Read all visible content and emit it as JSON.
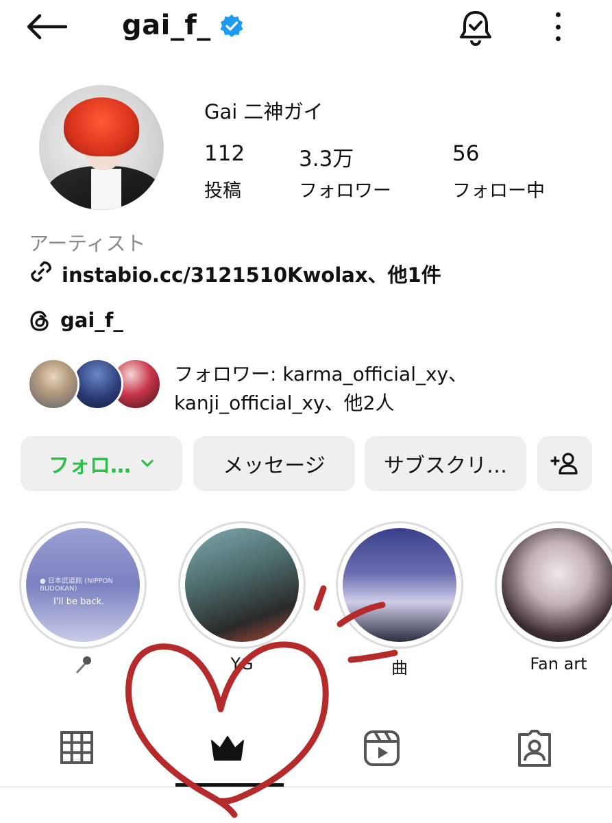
{
  "header": {
    "username": "gai_f_"
  },
  "profile": {
    "display_name": "Gai 二神ガイ",
    "stats": [
      {
        "value": "112",
        "label": "投稿"
      },
      {
        "value": "3.3万",
        "label": "フォロワー"
      },
      {
        "value": "56",
        "label": "フォロー中"
      }
    ],
    "category": "アーティスト",
    "link": "instabio.cc/3121510Kwolax、他1件",
    "threads_handle": "gai_f_",
    "followed_by_line1": "フォロワー: karma_official_xy、",
    "followed_by_line2": "kanji_official_xy、他2人"
  },
  "actions": {
    "follow_label": "フォロ…",
    "message_label": "メッセージ",
    "subscribe_label": "サブスクリ…"
  },
  "highlights": [
    {
      "label": "",
      "icon": "microphone-icon",
      "thumb_text_small": "● 日本武道館 (NIPPON BUDOKAN)",
      "thumb_text_big": "I'll be back."
    },
    {
      "label": "YG"
    },
    {
      "label": "曲"
    },
    {
      "label": "Fan art"
    }
  ],
  "tabs": {
    "selected_index": 1,
    "items": [
      "grid-icon",
      "crown-icon",
      "reels-icon",
      "tagged-icon"
    ]
  },
  "colors": {
    "accent_green": "#2dbf4a",
    "verified_blue": "#1d9bf0",
    "button_bg": "#efefef",
    "doodle_red": "#b52a2a"
  }
}
